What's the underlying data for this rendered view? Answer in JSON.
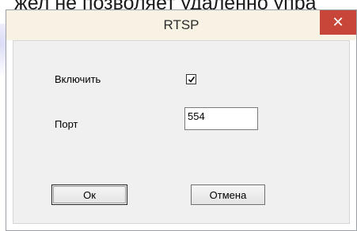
{
  "background": {
    "text": "жел не позволяет удаленно упра"
  },
  "dialog": {
    "title": "RTSP",
    "close_glyph": "✕"
  },
  "form": {
    "enable_label": "Включить",
    "enable_checked": true,
    "port_label": "Порт",
    "port_value": "554"
  },
  "buttons": {
    "ok_label": "Ок",
    "cancel_label": "Отмена"
  },
  "colors": {
    "close_button": "#c8453a",
    "titlebar": "#f7f2e3",
    "client_area": "#f0f0f0"
  },
  "icons": {
    "close": "close-icon",
    "checkmark": "checkmark-icon"
  }
}
